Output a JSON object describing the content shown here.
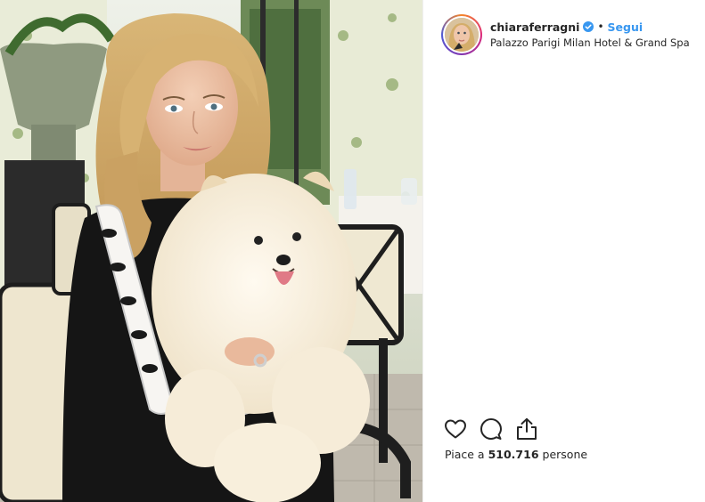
{
  "post": {
    "username": "chiaraferragni",
    "verified": true,
    "separator": "•",
    "follow_label": "Segui",
    "location": "Palazzo Parigi Milan Hotel & Grand Spa",
    "likes": {
      "prefix": "Piace a",
      "count": "510.716",
      "suffix": "persone"
    },
    "photo": {
      "description_icons": [
        "woman",
        "pomeranian-dog",
        "garden-window",
        "cafe-chair"
      ]
    },
    "actions": [
      {
        "name": "like-heart-icon"
      },
      {
        "name": "comment-bubble-icon"
      },
      {
        "name": "share-upload-icon"
      }
    ]
  },
  "colors": {
    "link": "#3897f0",
    "text": "#262626",
    "verified_badge": "#3897f0"
  }
}
